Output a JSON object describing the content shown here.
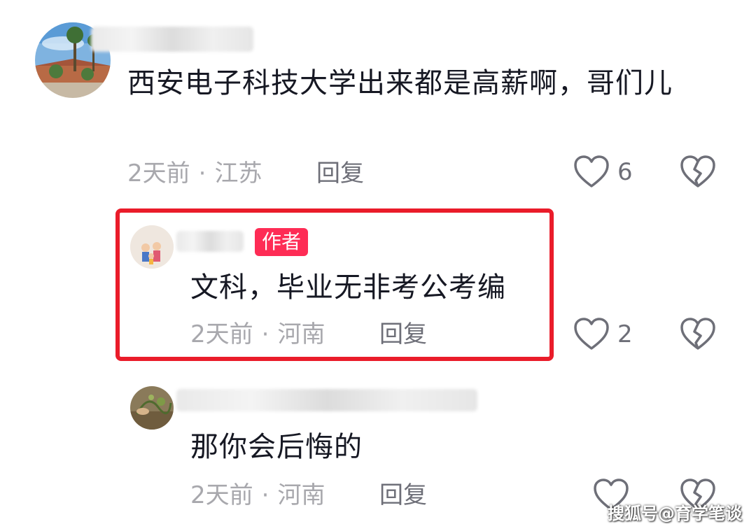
{
  "comments": [
    {
      "content": "西安电子科技大学出来都是高薪啊，哥们儿",
      "time": "2天前",
      "separator": "·",
      "location": "江苏",
      "reply_label": "回复",
      "like_count": "6"
    },
    {
      "badge": "作者",
      "content": "文科，毕业无非考公考编",
      "time": "2天前",
      "separator": "·",
      "location": "河南",
      "reply_label": "回复",
      "like_count": "2"
    },
    {
      "content": "那你会后悔的",
      "time": "2天前",
      "separator": "·",
      "location": "河南",
      "reply_label": "回复",
      "like_count": ""
    }
  ],
  "watermark": "搜狐号@育学笔谈",
  "colors": {
    "highlight_border": "#ea1c2a",
    "author_badge": "#fe2c55",
    "meta_text": "#a8a8ad",
    "reply_text": "#6e6f78",
    "icon_stroke": "#6e6f78"
  }
}
